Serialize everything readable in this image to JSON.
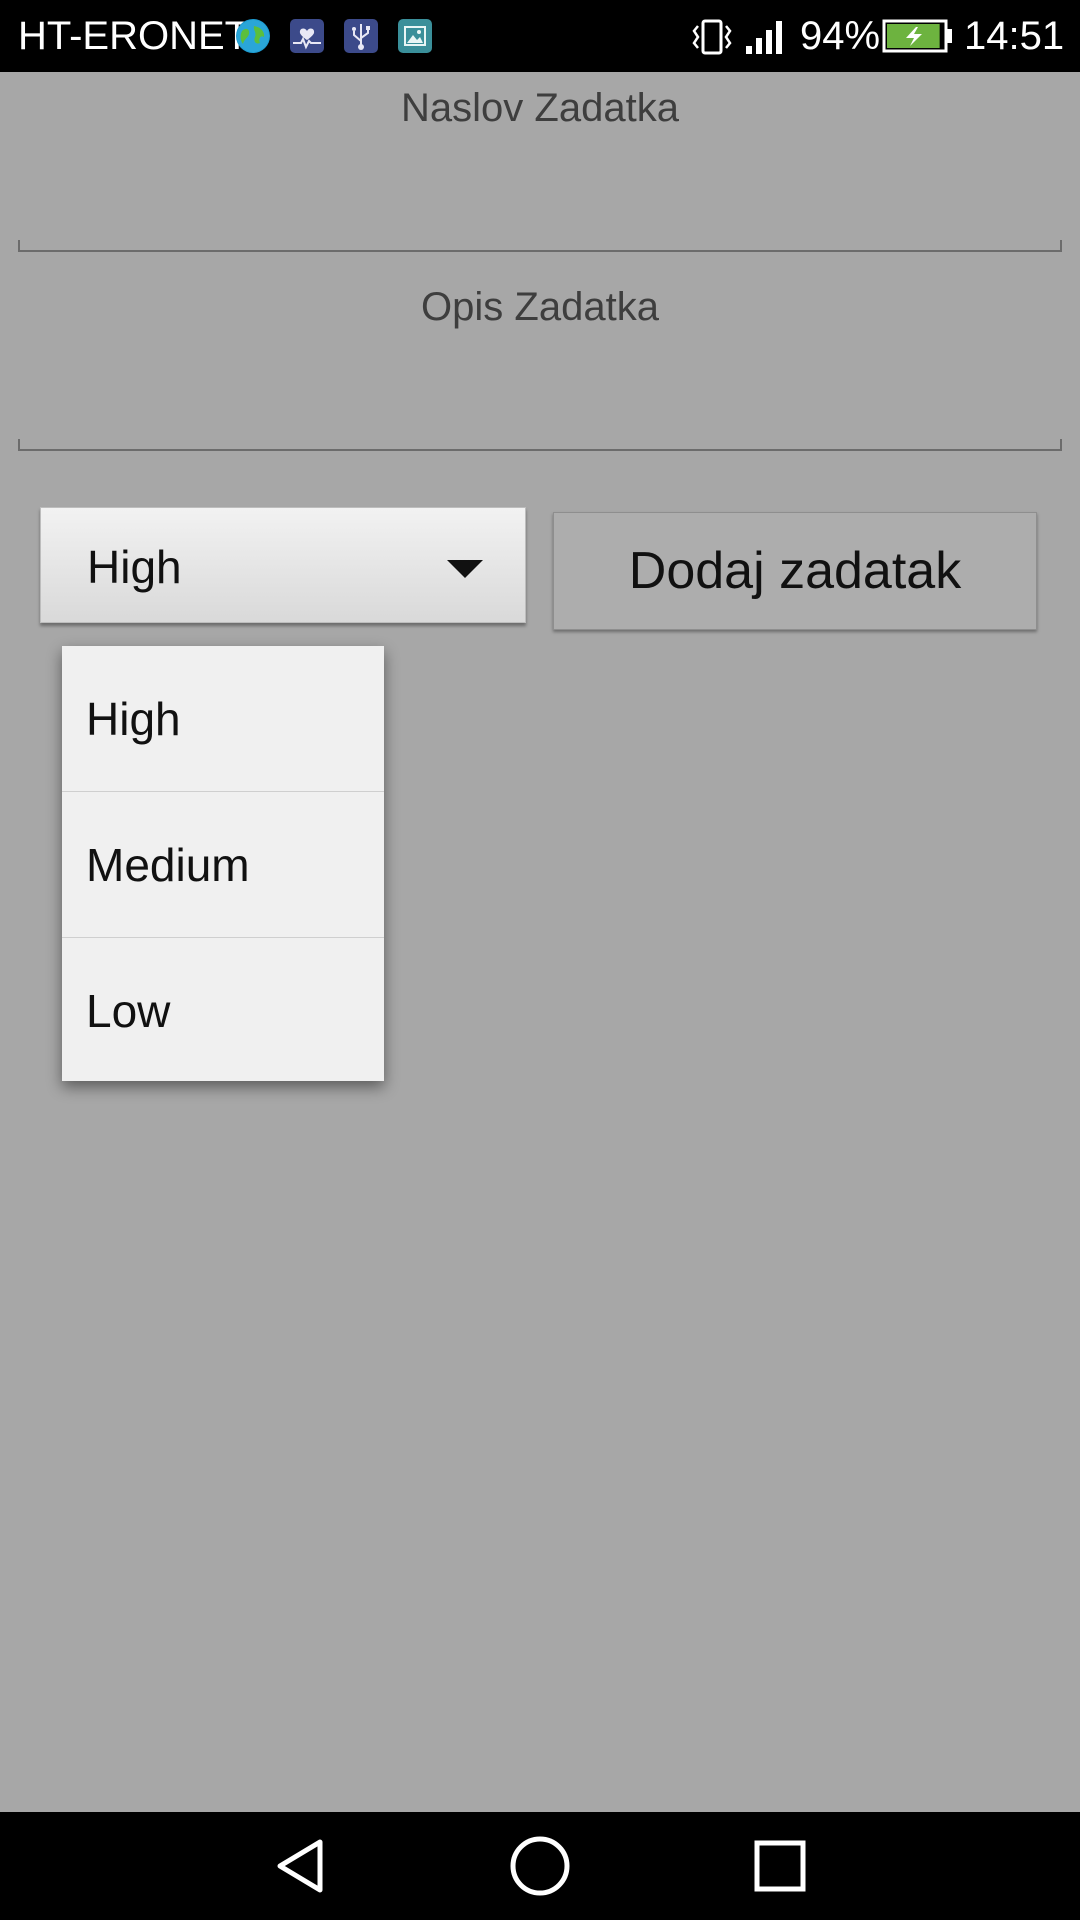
{
  "status_bar": {
    "carrier": "HT-ERONET",
    "battery_percent": "94%",
    "battery_level": 0.94,
    "time": "14:51",
    "notification_icons": [
      "globe-app-icon",
      "health-monitor-icon",
      "usb-icon",
      "image-icon"
    ]
  },
  "form": {
    "title_label": "Naslov Zadatka",
    "title_value": "",
    "description_label": "Opis Zadatka",
    "description_value": "",
    "priority_selected": "High",
    "add_button_label": "Dodaj zadatak"
  },
  "priority_dropdown": {
    "options": [
      "High",
      "Medium",
      "Low"
    ]
  },
  "navigation": {
    "icons": [
      "back-icon",
      "home-icon",
      "recents-icon"
    ]
  },
  "colors": {
    "background": "#a7a7a7",
    "status_bar": "#000000",
    "dropdown": "#f0f0f0",
    "battery_fill": "#6db33f"
  }
}
